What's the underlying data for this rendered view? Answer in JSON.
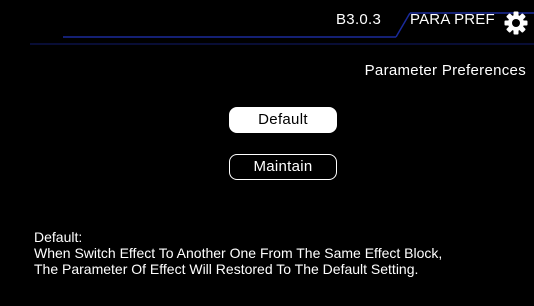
{
  "header": {
    "version": "B3.0.3",
    "page_label": "PARA PREF",
    "settings_icon": "gear-icon",
    "accent_color": "#1a2a9a"
  },
  "main": {
    "title": "Parameter Preferences",
    "options": [
      {
        "label": "Default",
        "selected": true
      },
      {
        "label": "Maintain",
        "selected": false
      }
    ]
  },
  "description": {
    "heading": "Default:",
    "lines": [
      "When Switch Effect To Another One From The Same Effect Block,",
      "The Parameter Of Effect Will Restored To The Default Setting."
    ]
  }
}
